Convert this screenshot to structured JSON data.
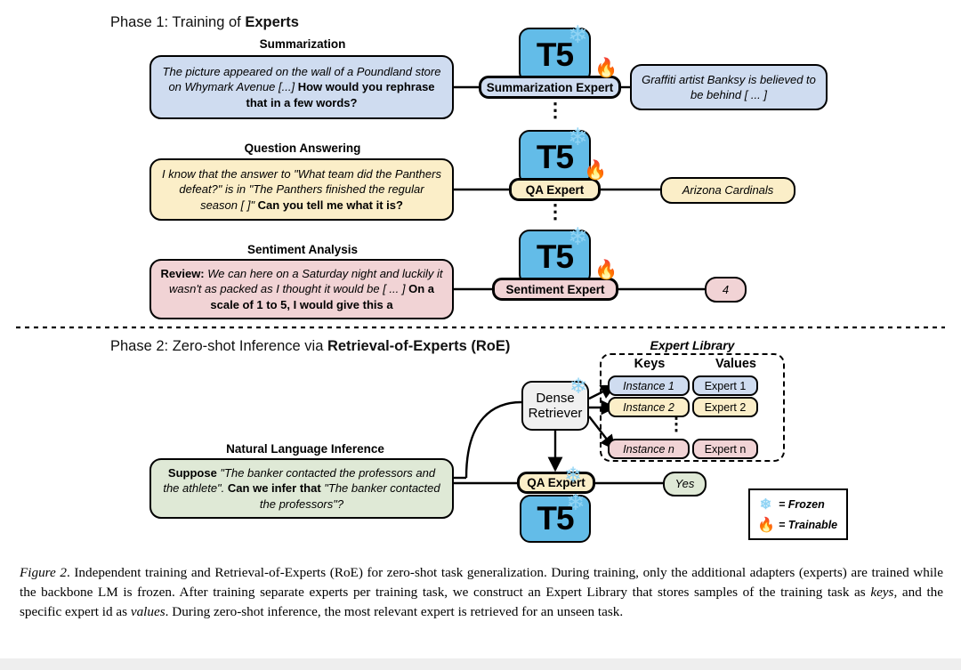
{
  "phase1": {
    "title_prefix": "Phase 1: Training of ",
    "title_bold": "Experts",
    "rows": [
      {
        "task_label": "Summarization",
        "prompt_plain1": "The picture appeared on the wall of a Poundland store on Whymark Avenue [...] ",
        "prompt_bold": "How would you rephrase that in a few words?",
        "expert_label": "Summarization Expert",
        "output": "Graffiti artist Banksy is believed to be behind [ ... ]",
        "backbone": "T5"
      },
      {
        "task_label": "Question Answering",
        "prompt_plain1": "I know that the answer to \"What team did the Panthers defeat?\" is in \"The Panthers finished the regular season [   ]\" ",
        "prompt_bold": "Can you tell me what it is?",
        "expert_label": "QA Expert",
        "output": "Arizona Cardinals",
        "backbone": "T5"
      },
      {
        "task_label": "Sentiment Analysis",
        "prompt_bold_lead": "Review:",
        "prompt_plain1": " We can here on a Saturday night and luckily it wasn't as packed as I thought it would be [ ... ] ",
        "prompt_bold": "On a scale of 1 to 5, I would give this a",
        "expert_label": "Sentiment Expert",
        "output": "4",
        "backbone": "T5"
      }
    ]
  },
  "phase2": {
    "title_prefix": "Phase 2: Zero-shot Inference via ",
    "title_bold": "Retrieval-of-Experts (RoE)",
    "task_label": "Natural Language Inference",
    "prompt_bold_lead": "Suppose",
    "prompt_quote1": " \"The banker contacted the professors and the athlete\". ",
    "prompt_bold_mid": "Can we infer that",
    "prompt_quote2": " \"The banker contacted the professors\"?",
    "retriever_line1": "Dense",
    "retriever_line2": "Retriever",
    "expert_label": "QA Expert",
    "backbone": "T5",
    "output": "Yes",
    "library": {
      "title": "Expert Library",
      "col_keys": "Keys",
      "col_values": "Values",
      "rows": [
        {
          "key": "Instance 1",
          "value": "Expert 1",
          "color": "blue"
        },
        {
          "key": "Instance 2",
          "value": "Expert 2",
          "color": "yellow"
        },
        {
          "key": "Instance n",
          "value": "Expert n",
          "color": "pink"
        }
      ]
    }
  },
  "legend": {
    "frozen_glyph": "❄",
    "frozen_label": "= Frozen",
    "trainable_glyph": "🔥",
    "trainable_label": "= Trainable"
  },
  "icons": {
    "snowflake": "❄",
    "flame": "🔥",
    "vdots": "⋮"
  },
  "caption": {
    "figure_num": "Figure 2",
    "text_a": ". Independent training and Retrieval-of-Experts (RoE) for zero-shot task generalization. During training, only the additional adapters (experts) are trained while the backbone LM is frozen. After training separate experts per training task, we construct an Expert Library that stores samples of the training task as ",
    "em_keys": "keys",
    "text_b": ", and the specific expert id as ",
    "em_values": "values",
    "text_c": ". During zero-shot inference, the most relevant expert is retrieved for an unseen task."
  },
  "colors": {
    "blue": "#cfdcf0",
    "yellow": "#fbeec8",
    "pink": "#f1d3d5",
    "green": "#dfe9d6",
    "t5": "#63bce8",
    "gray": "#f0f0f0"
  }
}
